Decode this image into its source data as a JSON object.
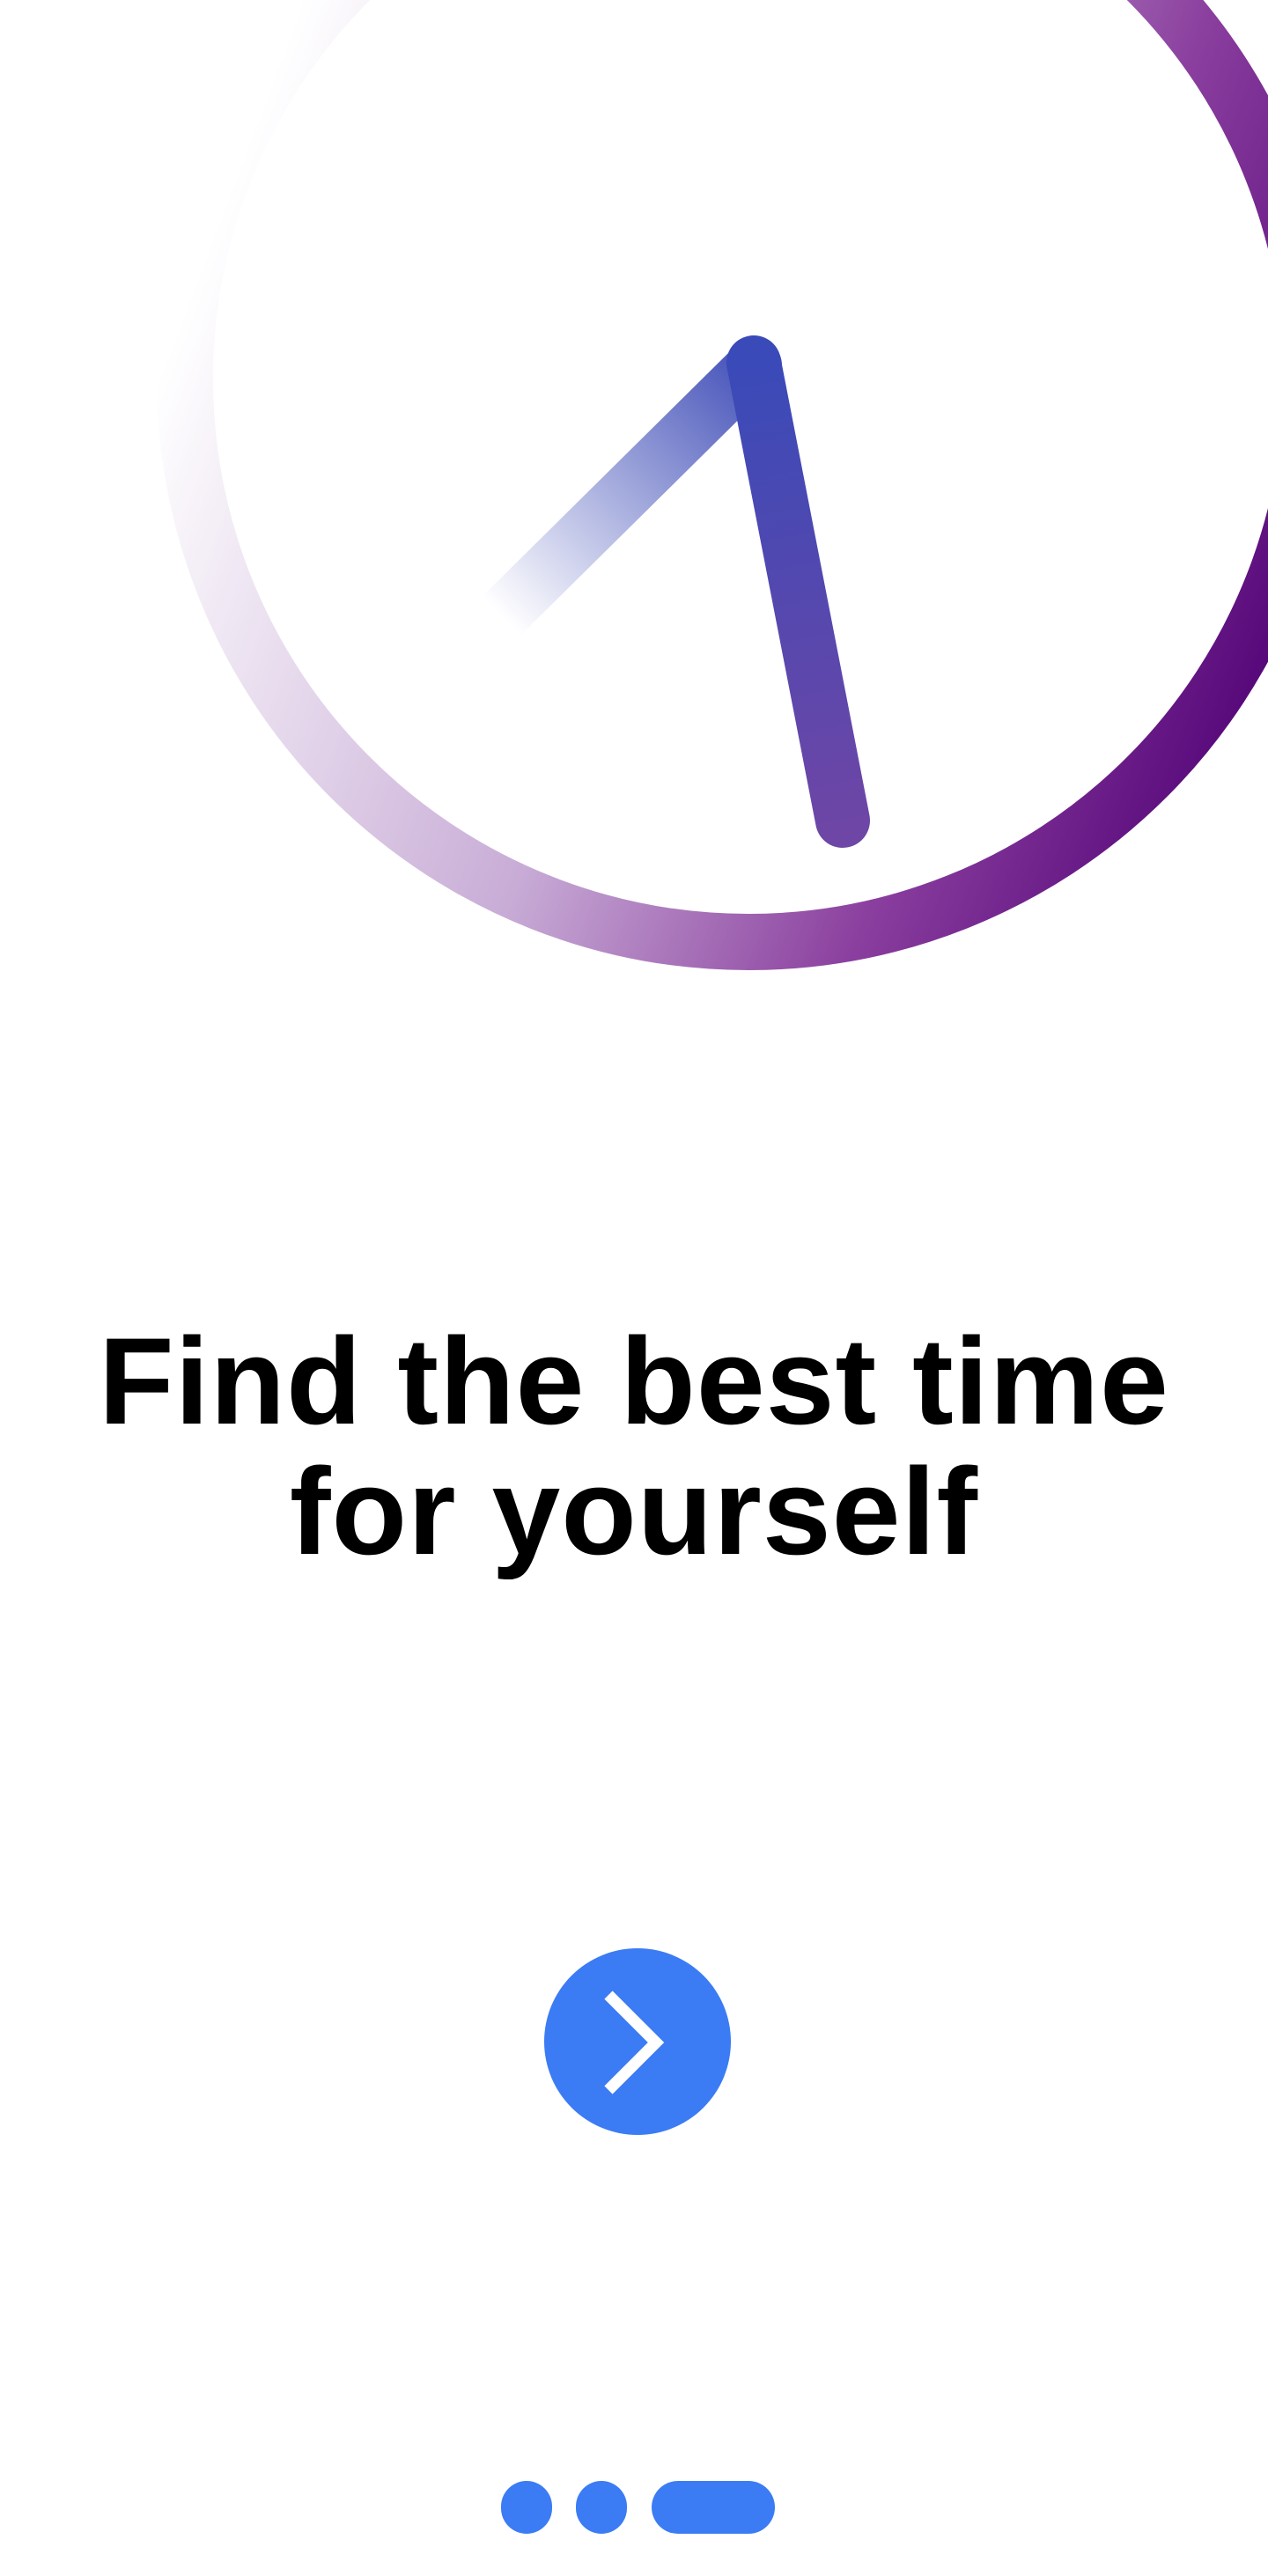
{
  "illustration": {
    "icon": "clock-icon",
    "ring_gradient": [
      "#ffffff",
      "#b898c8",
      "#5a0a7c"
    ],
    "hand_gradient": [
      "#ffffff",
      "#3d4ab8",
      "#6a4aa8"
    ]
  },
  "headline": {
    "line1": "Find the best time",
    "line2": "for yourself"
  },
  "next_button": {
    "icon": "chevron-right-icon",
    "color": "#3b7cf4"
  },
  "pager": {
    "count": 3,
    "active_index": 2,
    "color": "#3b7cf4"
  }
}
